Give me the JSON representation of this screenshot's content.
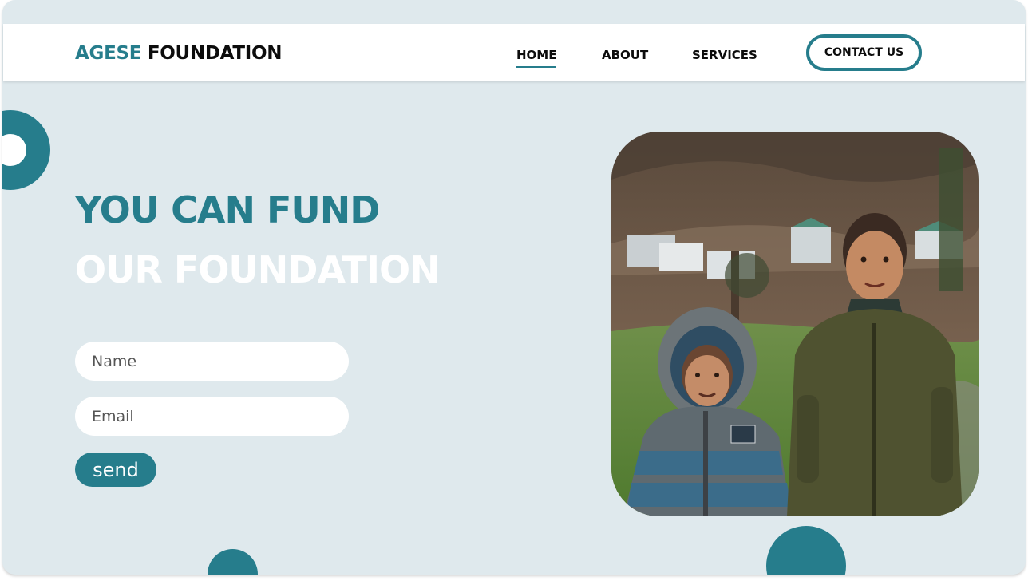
{
  "brand": {
    "accent_text": "AGESE",
    "main_text": "FOUNDATION",
    "accent_color": "#267d8c"
  },
  "nav": {
    "items": [
      {
        "label": "HOME",
        "active": true
      },
      {
        "label": "ABOUT",
        "active": false
      },
      {
        "label": "SERVICES",
        "active": false
      }
    ],
    "contact_label": "CONTACT US"
  },
  "hero": {
    "line1": "YOU CAN FUND",
    "line2": "OUR FOUNDATION"
  },
  "form": {
    "name_placeholder": "Name",
    "email_placeholder": "Email",
    "send_label": "send"
  },
  "image": {
    "subject": "two children in winter jackets outdoors"
  },
  "colors": {
    "page_bg": "#dfe9ed",
    "accent": "#267d8c",
    "nav_bg": "#ffffff"
  }
}
